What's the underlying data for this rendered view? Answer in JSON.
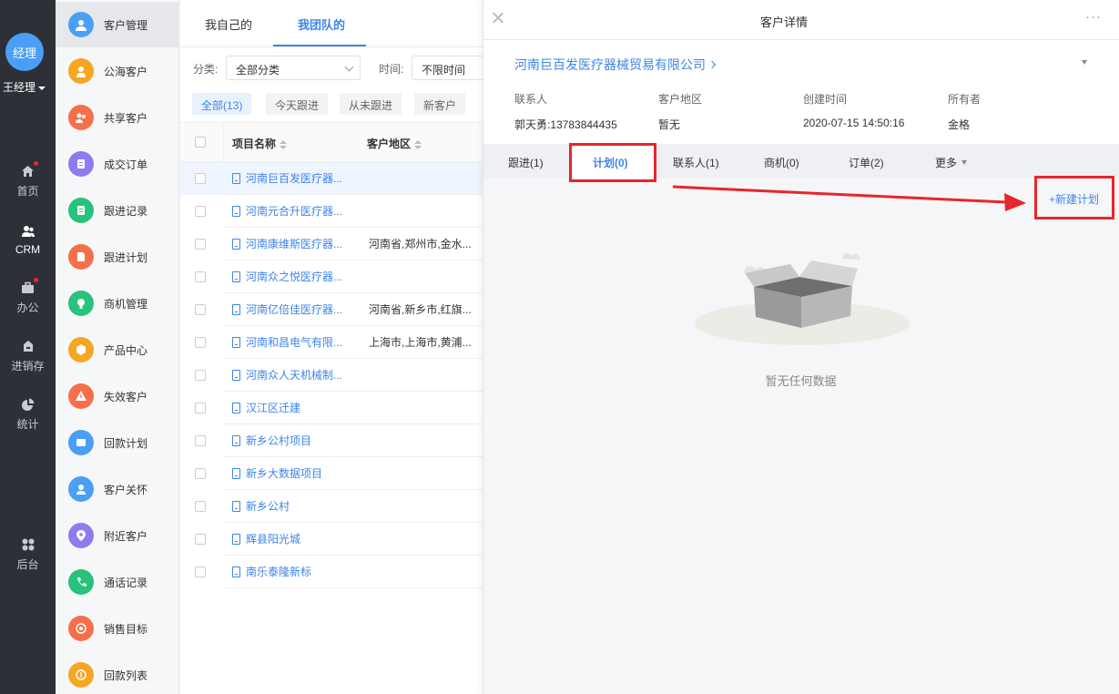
{
  "user": {
    "avatar_text": "经理",
    "name": "王经理"
  },
  "rail": [
    {
      "label": "首页",
      "icon": "home-icon",
      "dot": true
    },
    {
      "label": "CRM",
      "icon": "crm-icon",
      "active": true
    },
    {
      "label": "办公",
      "icon": "briefcase-icon",
      "dot": true
    },
    {
      "label": "进销存",
      "icon": "store-icon"
    },
    {
      "label": "统计",
      "icon": "pie-chart-icon"
    },
    {
      "label": "后台",
      "icon": "settings-grid-icon"
    }
  ],
  "subnav": [
    {
      "label": "客户管理",
      "color": "#4a9ff5",
      "icon": "customers-icon",
      "active": true
    },
    {
      "label": "公海客户",
      "color": "#f5a623",
      "icon": "public-customer-icon"
    },
    {
      "label": "共享客户",
      "color": "#f5704a",
      "icon": "shared-customer-icon"
    },
    {
      "label": "成交订单",
      "color": "#8c7cf0",
      "icon": "order-icon"
    },
    {
      "label": "跟进记录",
      "color": "#27c27c",
      "icon": "follow-record-icon"
    },
    {
      "label": "跟进计划",
      "color": "#f5704a",
      "icon": "follow-plan-icon"
    },
    {
      "label": "商机管理",
      "color": "#27c27c",
      "icon": "opportunity-icon"
    },
    {
      "label": "产品中心",
      "color": "#f5a623",
      "icon": "product-icon"
    },
    {
      "label": "失效客户",
      "color": "#f5704a",
      "icon": "warning-icon"
    },
    {
      "label": "回款计划",
      "color": "#4a9ff5",
      "icon": "payment-plan-icon"
    },
    {
      "label": "客户关怀",
      "color": "#4a9ff5",
      "icon": "care-icon"
    },
    {
      "label": "附近客户",
      "color": "#8c7cf0",
      "icon": "location-icon"
    },
    {
      "label": "通话记录",
      "color": "#27c27c",
      "icon": "phone-icon"
    },
    {
      "label": "销售目标",
      "color": "#f5704a",
      "icon": "target-icon"
    },
    {
      "label": "回款列表",
      "color": "#f5a623",
      "icon": "payment-list-icon"
    }
  ],
  "list": {
    "tabs": [
      "我自己的",
      "我团队的"
    ],
    "filter_category_label": "分类:",
    "filter_category_value": "全部分类",
    "filter_time_label": "时间:",
    "filter_time_value": "不限时间",
    "chips": [
      "全部(13)",
      "今天跟进",
      "从未跟进",
      "新客户"
    ],
    "col_name": "项目名称",
    "col_region": "客户地区",
    "rows": [
      {
        "name": "河南巨百发医疗器...",
        "region": ""
      },
      {
        "name": "河南元合升医疗器...",
        "region": ""
      },
      {
        "name": "河南康维斯医疗器...",
        "region": "河南省,郑州市,金水..."
      },
      {
        "name": "河南众之悦医疗器...",
        "region": ""
      },
      {
        "name": "河南亿倍佳医疗器...",
        "region": "河南省,新乡市,红旗..."
      },
      {
        "name": "河南和昌电气有限...",
        "region": "上海市,上海市,黄浦..."
      },
      {
        "name": "河南众人天机械制...",
        "region": ""
      },
      {
        "name": "汉江区迁建",
        "region": ""
      },
      {
        "name": "新乡公村项目",
        "region": ""
      },
      {
        "name": "新乡大数据项目",
        "region": ""
      },
      {
        "name": "新乡公村",
        "region": ""
      },
      {
        "name": "辉县阳光城",
        "region": ""
      },
      {
        "name": "南乐泰隆新标",
        "region": ""
      }
    ]
  },
  "detail": {
    "title": "客户详情",
    "more": "···",
    "company": "河南巨百发医疗器械贸易有限公司",
    "fields": [
      {
        "label": "联系人",
        "value": "郭天勇:13783844435"
      },
      {
        "label": "客户地区",
        "value": "暂无"
      },
      {
        "label": "创建时间",
        "value": "2020-07-15 14:50:16"
      },
      {
        "label": "所有者",
        "value": "金格"
      }
    ],
    "tabs": [
      "跟进(1)",
      "计划(0)",
      "联系人(1)",
      "商机(0)",
      "订单(2)",
      "更多"
    ],
    "new_plan": "+新建计划",
    "empty_text": "暂无任何数据"
  },
  "colors": {
    "accent": "#3e84e9",
    "highlight": "#e8262b",
    "rail_bg": "#2d3037"
  }
}
